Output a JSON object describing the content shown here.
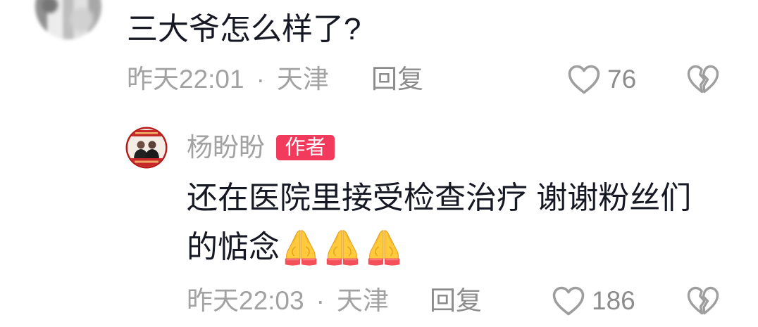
{
  "comment": {
    "text": "三大爷怎么样了?",
    "time": "昨天22:01",
    "separator": "·",
    "location": "天津",
    "reply_label": "回复",
    "like_count": "76",
    "like_icon": "heart-outline-icon",
    "dislike_icon": "broken-heart-icon"
  },
  "reply": {
    "author": "杨盼盼",
    "author_badge": "作者",
    "text_line_1": "还在医院里接受检查治疗 谢谢粉丝们",
    "text_line_2": "的惦念",
    "emoji_icons": [
      "praying-hands",
      "praying-hands",
      "praying-hands"
    ],
    "time": "昨天22:03",
    "separator": "·",
    "location": "天津",
    "reply_label": "回复",
    "like_count": "186",
    "like_icon": "heart-outline-icon",
    "dislike_icon": "broken-heart-icon"
  },
  "colors": {
    "text_primary": "#161823",
    "text_secondary": "#A2A2A2",
    "action_text": "#8C8C8C",
    "badge_background": "#F23A5C",
    "badge_text": "#FFFFFF",
    "icon": "#9E9E9E"
  }
}
